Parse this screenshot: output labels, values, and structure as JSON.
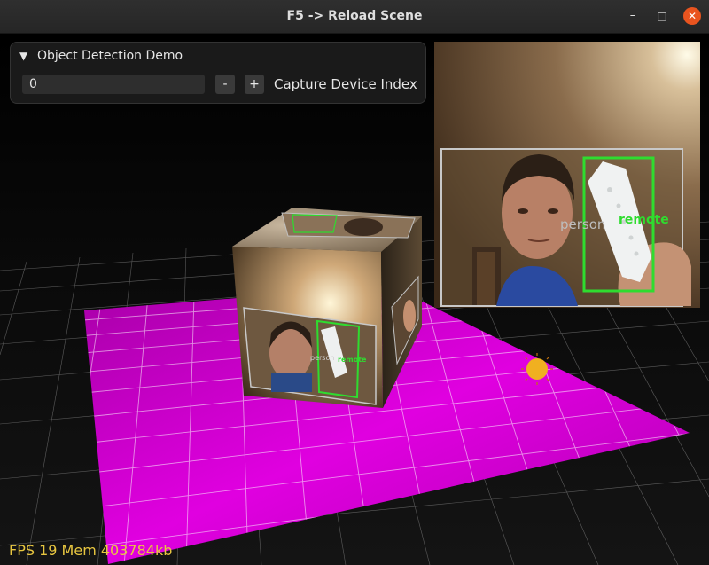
{
  "window": {
    "title": "F5 -> Reload Scene",
    "controls": {
      "minimize": "–",
      "maximize": "□",
      "close": "✕"
    }
  },
  "panel": {
    "title": "Object Detection Demo",
    "collapse_glyph": "▼",
    "input_value": "0",
    "minus_label": "-",
    "plus_label": "+",
    "input_label": "Capture Device Index"
  },
  "detections": [
    {
      "label": "person",
      "color": "#bdbdbd"
    },
    {
      "label": "remote",
      "color": "#2fdc2f"
    }
  ],
  "status": {
    "text": "FPS 19 Mem 403784kb"
  },
  "colors": {
    "floor": "#d400d4",
    "grid": "#ffffff",
    "sun": "#f0b020",
    "box_detection": "#2fdc2f"
  }
}
